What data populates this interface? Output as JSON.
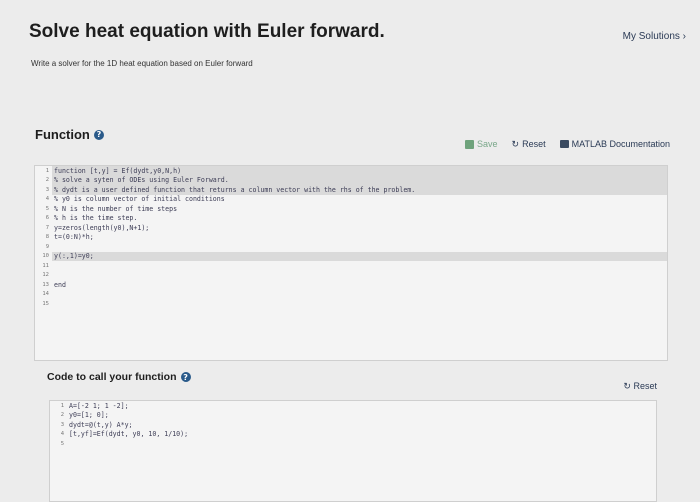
{
  "header": {
    "title": "Solve heat equation with Euler forward.",
    "my_solutions": "My Solutions ›",
    "subtitle": "Write a solver for the 1D heat equation based on Euler forward"
  },
  "function_section": {
    "heading": "Function",
    "toolbar": {
      "save_label": "Save",
      "reset_label": "Reset",
      "doc_label": "MATLAB Documentation"
    },
    "lines": [
      {
        "n": "1",
        "text": "function [t,y] = Ef(dydt,y0,N,h)"
      },
      {
        "n": "2",
        "text": "% solve a syten of ODEs using Euler Forward."
      },
      {
        "n": "3",
        "text": "% dydt is a user defined function that returns a column vector with the rhs of the problem."
      },
      {
        "n": "4",
        "text": "% y0 is column vector of initial conditions"
      },
      {
        "n": "5",
        "text": "% N is the number of time steps"
      },
      {
        "n": "6",
        "text": "% h is the time step."
      },
      {
        "n": "7",
        "text": "y=zeros(length(y0),N+1);"
      },
      {
        "n": "8",
        "text": "t=(0:N)*h;"
      },
      {
        "n": "9",
        "text": ""
      },
      {
        "n": "10",
        "text": "y(:,1)=y0;"
      },
      {
        "n": "11",
        "text": ""
      },
      {
        "n": "12",
        "text": ""
      },
      {
        "n": "13",
        "text": "end"
      },
      {
        "n": "14",
        "text": ""
      },
      {
        "n": "15",
        "text": ""
      }
    ]
  },
  "call_section": {
    "heading": "Code to call your function",
    "reset_label": "Reset",
    "lines": [
      {
        "n": "1",
        "text": "A=[-2 1; 1 -2];"
      },
      {
        "n": "2",
        "text": "y0=[1; 0];"
      },
      {
        "n": "3",
        "text": "dydt=@(t,y) A*y;"
      },
      {
        "n": "4",
        "text": "[t,yf]=Ef(dydt, y0, 10, 1/10);"
      },
      {
        "n": "5",
        "text": ""
      }
    ]
  },
  "icons": {
    "help": "help-circle-icon",
    "save": "save-icon",
    "reset": "reset-icon",
    "doc": "book-icon"
  }
}
